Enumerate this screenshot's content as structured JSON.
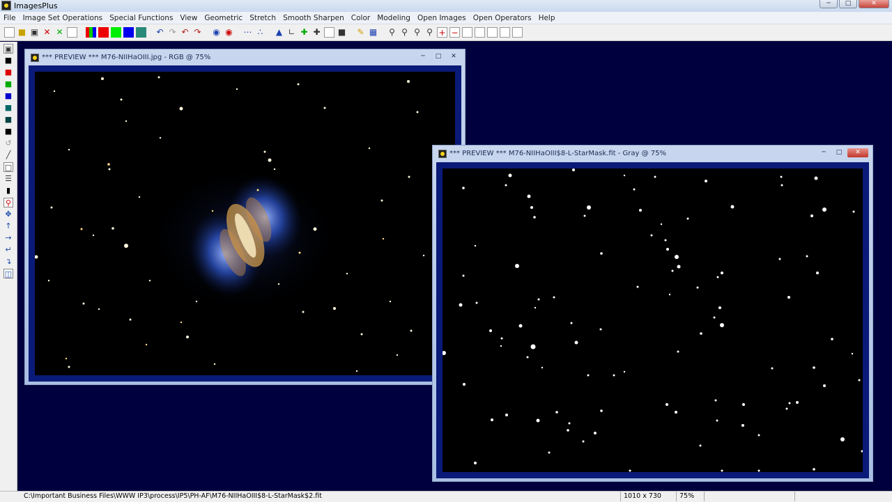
{
  "app": {
    "title": "ImagesPlus"
  },
  "menu": [
    "File",
    "Image Set Operations",
    "Special Functions",
    "View",
    "Geometric",
    "Stretch",
    "Smooth Sharpen",
    "Color",
    "Modeling",
    "Open Images",
    "Open Operators",
    "Help"
  ],
  "preview1": {
    "title": "*** PREVIEW *** M76-NIIHaOIII.jpg - RGB @ 75%"
  },
  "preview2": {
    "title": "*** PREVIEW *** M76-NIIHaOIII$8-L-StarMask.fit - Gray @ 75%"
  },
  "status": {
    "path": "C:\\Important Business Files\\WWW IP3\\process\\IP5\\PH-AF\\M76-NIIHaOIII$8-L-StarMask$2.fit",
    "dimensions": "1010 x 730",
    "zoom": "75%"
  },
  "colors": {
    "workspace": "#00003e",
    "frame": "#0a1a78"
  },
  "icons": [
    "app-icon",
    "new-icon",
    "open-icon",
    "save-icon",
    "close-icon",
    "zoom-in-icon",
    "zoom-out-icon",
    "undo-icon",
    "redo-icon"
  ]
}
